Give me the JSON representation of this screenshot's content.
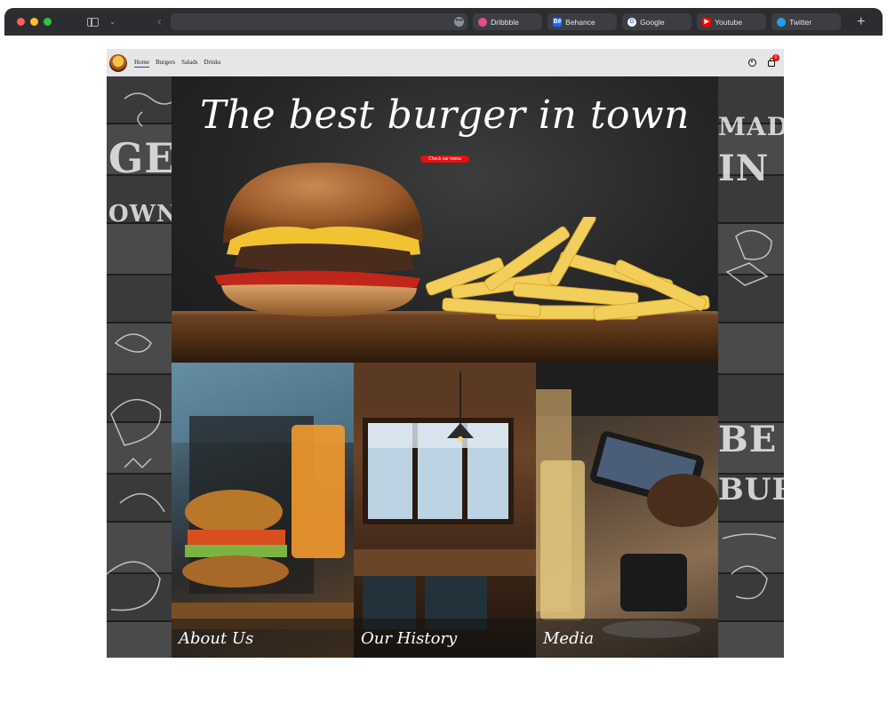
{
  "browser": {
    "tabs": [
      {
        "label": "Dribbble",
        "icon": "dribbble-icon"
      },
      {
        "label": "Behance",
        "icon": "behance-icon"
      },
      {
        "label": "Google",
        "icon": "google-icon"
      },
      {
        "label": "Youtube",
        "icon": "youtube-icon"
      },
      {
        "label": "Twitter",
        "icon": "twitter-icon"
      }
    ]
  },
  "site": {
    "nav": {
      "links": [
        "Home",
        "Burgers",
        "Salads",
        "Drinks"
      ],
      "active": "Home",
      "cart_count": "0"
    },
    "hero": {
      "title": "The best burger in town",
      "button_label": "Check our menu"
    },
    "tiles": [
      {
        "caption": "About Us"
      },
      {
        "caption": "Our History"
      },
      {
        "caption": "Media"
      }
    ],
    "chalk": {
      "left_lines": [
        "GE,",
        "OWN"
      ],
      "right_lines": [
        "MADE",
        "IN",
        "BE",
        "BUR"
      ]
    },
    "colors": {
      "accent_red": "#e51010",
      "nav_bg": "#e6e6e6",
      "active_underline": "#5b2fa6"
    }
  }
}
